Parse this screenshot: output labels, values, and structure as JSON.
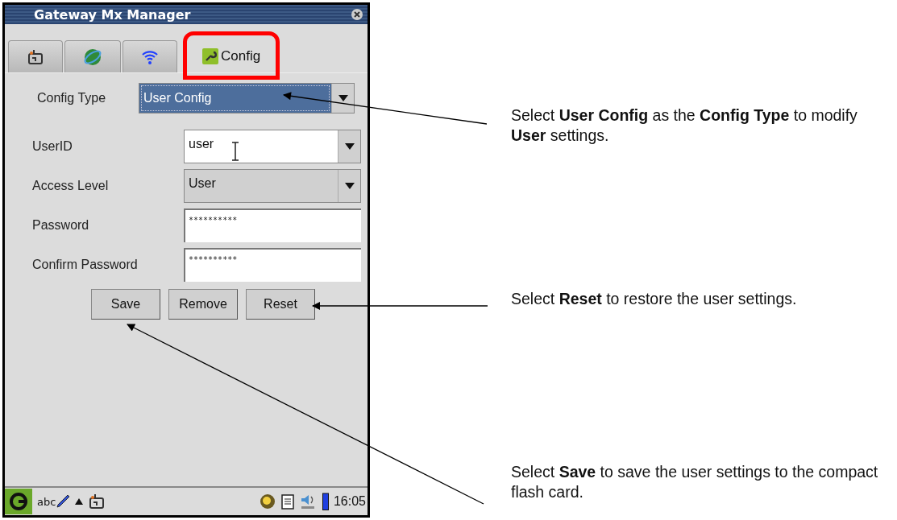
{
  "window": {
    "title": "Gateway Mx Manager"
  },
  "tabs": [
    {
      "selected": false,
      "highlighted": false
    },
    {
      "selected": false,
      "highlighted": false
    },
    {
      "selected": false,
      "highlighted": false
    },
    {
      "label": "Config",
      "selected": true,
      "highlighted": true
    }
  ],
  "config_type": {
    "label": "Config Type",
    "value": "User Config",
    "focused": true
  },
  "fields": [
    {
      "kind": "dropdown",
      "label": "UserID",
      "value": "user",
      "editable": true
    },
    {
      "kind": "dropdown",
      "label": "Access Level",
      "value": "User",
      "editable": false
    },
    {
      "kind": "text",
      "label": "Password",
      "value": "**********"
    },
    {
      "kind": "text",
      "label": "Confirm Password",
      "value": "**********"
    }
  ],
  "buttons": [
    "Save",
    "Remove",
    "Reset"
  ],
  "taskbar": {
    "input_label": "abc",
    "clock": "16:05"
  },
  "callouts": [
    {
      "text": "Select **User Config** as the **Config Type** to modify **User** settings."
    },
    {
      "text": "Select **Reset** to restore the user settings."
    },
    {
      "text": "Select **Save** to save the user settings to the compact flash card."
    }
  ]
}
